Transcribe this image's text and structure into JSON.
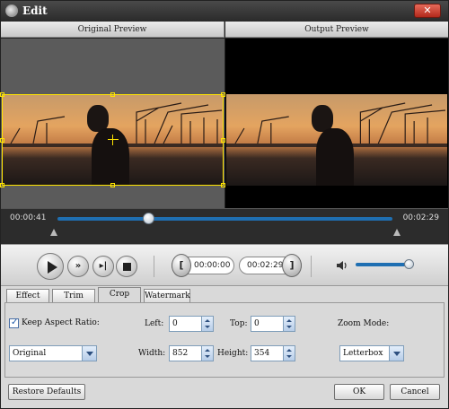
{
  "window": {
    "title": "Edit",
    "close_label": "✕"
  },
  "preview": {
    "original_label": "Original Preview",
    "output_label": "Output Preview"
  },
  "timeline": {
    "current_time": "00:00:41",
    "total_time": "00:02:29",
    "progress": 0.27
  },
  "transport": {
    "start_time": "00:00:00",
    "end_time": "00:02:29",
    "start_bracket": "[",
    "end_bracket": "]",
    "volume": 0.9
  },
  "tabs": [
    {
      "label": "Effect"
    },
    {
      "label": "Trim"
    },
    {
      "label": "Crop"
    },
    {
      "label": "Watermark"
    }
  ],
  "active_tab": "Crop",
  "crop": {
    "keep_aspect_label": "Keep Aspect Ratio:",
    "keep_aspect_checked": true,
    "left_label": "Left:",
    "left_value": "0",
    "top_label": "Top:",
    "top_value": "0",
    "zoom_mode_label": "Zoom Mode:",
    "aspect_select_value": "Original",
    "width_label": "Width:",
    "width_value": "852",
    "height_label": "Height:",
    "height_value": "354",
    "zoom_select_value": "Letterbox"
  },
  "buttons": {
    "restore": "Restore Defaults",
    "ok": "OK",
    "cancel": "Cancel"
  },
  "colors": {
    "crop_border": "#ffe400",
    "accent_blue": "#1f6fb2"
  }
}
